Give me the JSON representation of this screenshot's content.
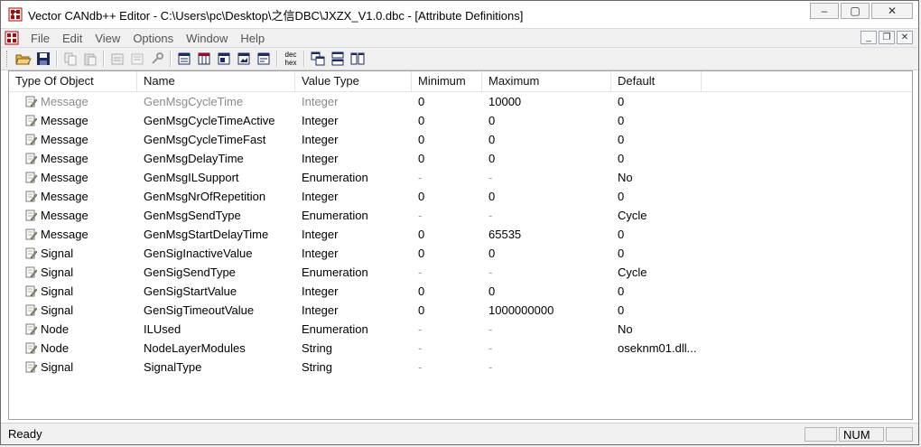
{
  "window": {
    "title": "Vector CANdb++ Editor - C:\\Users\\pc\\Desktop\\之信DBC\\JXZX_V1.0.dbc - [Attribute Definitions]",
    "minimize_glyph": "–",
    "restore_glyph": "▢",
    "close_glyph": "✕"
  },
  "menu": {
    "items": [
      "File",
      "Edit",
      "View",
      "Options",
      "Window",
      "Help"
    ],
    "mdi_minimize": "_",
    "mdi_restore": "❐",
    "mdi_close": "✕"
  },
  "toolbar": {
    "dec_hex_top": "dec",
    "dec_hex_bottom": "hex"
  },
  "table": {
    "columns": [
      "Type Of Object",
      "Name",
      "Value Type",
      "Minimum",
      "Maximum",
      "Default"
    ],
    "rows": [
      {
        "type": "Message",
        "name": "GenMsgCycleTime",
        "value_type": "Integer",
        "min": "0",
        "max": "10000",
        "default": "0"
      },
      {
        "type": "Message",
        "name": "GenMsgCycleTimeActive",
        "value_type": "Integer",
        "min": "0",
        "max": "0",
        "default": "0"
      },
      {
        "type": "Message",
        "name": "GenMsgCycleTimeFast",
        "value_type": "Integer",
        "min": "0",
        "max": "0",
        "default": "0"
      },
      {
        "type": "Message",
        "name": "GenMsgDelayTime",
        "value_type": "Integer",
        "min": "0",
        "max": "0",
        "default": "0"
      },
      {
        "type": "Message",
        "name": "GenMsgILSupport",
        "value_type": "Enumeration",
        "min": "-",
        "max": "-",
        "default": "No"
      },
      {
        "type": "Message",
        "name": "GenMsgNrOfRepetition",
        "value_type": "Integer",
        "min": "0",
        "max": "0",
        "default": "0"
      },
      {
        "type": "Message",
        "name": "GenMsgSendType",
        "value_type": "Enumeration",
        "min": "-",
        "max": "-",
        "default": "Cycle"
      },
      {
        "type": "Message",
        "name": "GenMsgStartDelayTime",
        "value_type": "Integer",
        "min": "0",
        "max": "65535",
        "default": "0"
      },
      {
        "type": "Signal",
        "name": "GenSigInactiveValue",
        "value_type": "Integer",
        "min": "0",
        "max": "0",
        "default": "0"
      },
      {
        "type": "Signal",
        "name": "GenSigSendType",
        "value_type": "Enumeration",
        "min": "-",
        "max": "-",
        "default": "Cycle"
      },
      {
        "type": "Signal",
        "name": "GenSigStartValue",
        "value_type": "Integer",
        "min": "0",
        "max": "0",
        "default": "0"
      },
      {
        "type": "Signal",
        "name": "GenSigTimeoutValue",
        "value_type": "Integer",
        "min": "0",
        "max": "1000000000",
        "default": "0"
      },
      {
        "type": "Node",
        "name": "ILUsed",
        "value_type": "Enumeration",
        "min": "-",
        "max": "-",
        "default": "No"
      },
      {
        "type": "Node",
        "name": "NodeLayerModules",
        "value_type": "String",
        "min": "-",
        "max": "-",
        "default": "oseknm01.dll..."
      },
      {
        "type": "Signal",
        "name": "SignalType",
        "value_type": "String",
        "min": "-",
        "max": "-",
        "default": ""
      }
    ]
  },
  "status": {
    "text": "Ready",
    "num": "NUM"
  }
}
